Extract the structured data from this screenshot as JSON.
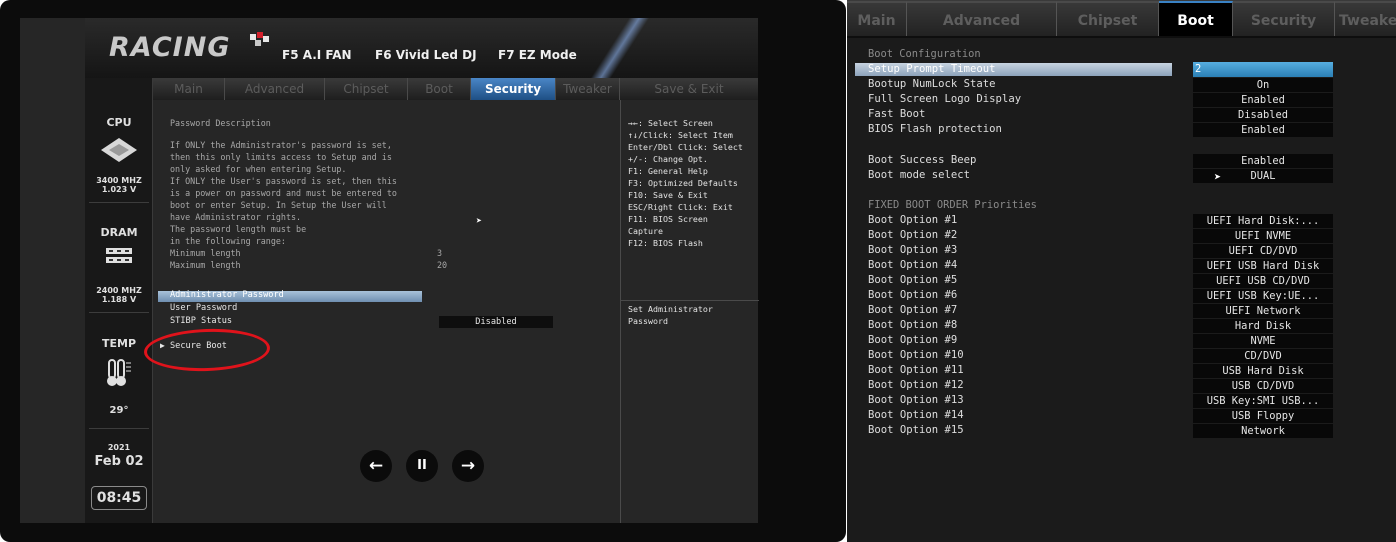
{
  "left_screen": {
    "logo_text": "RACING",
    "hotkeys": [
      "F5 A.I FAN",
      "F6 Vivid Led DJ",
      "F7 EZ Mode"
    ],
    "sidebar": {
      "cpu_label": "CPU",
      "cpu_freq": "3400 MHZ",
      "cpu_volt": "1.023 V",
      "dram_label": "DRAM",
      "dram_freq": "2400 MHZ",
      "dram_volt": "1.188 V",
      "temp_label": "TEMP",
      "temp_value": "29°",
      "year": "2021",
      "date": "Feb 02",
      "time": "08:45"
    },
    "tabs": [
      "Main",
      "Advanced",
      "Chipset",
      "Boot",
      "Security",
      "Tweaker",
      "Save & Exit"
    ],
    "active_tab": "Security",
    "description_lines": [
      "Password Description",
      "",
      "If ONLY the Administrator's password is set,",
      "then this only limits access to Setup and is",
      "only asked for when entering Setup.",
      "If ONLY the User's password is set, then this",
      "is a power on password and must be entered to",
      "boot or enter Setup. In Setup the User will",
      "have Administrator rights.",
      "The password length must be",
      "in the following range:"
    ],
    "min_length_label": "Minimum length",
    "min_length_value": "3",
    "max_length_label": "Maximum length",
    "max_length_value": "20",
    "items": {
      "admin_password": "Administrator Password",
      "user_password": "User Password",
      "stibp_label": "STIBP Status",
      "stibp_value": "Disabled",
      "secure_boot": "Secure Boot"
    },
    "help_keys": [
      "→←: Select Screen",
      "↑↓/Click: Select Item",
      "Enter/Dbl Click: Select",
      "+/-: Change Opt.",
      "F1: General Help",
      "F3: Optimized Defaults",
      "F10: Save & Exit",
      "ESC/Right Click: Exit",
      "F11: BIOS Screen",
      "Capture",
      "F12: BIOS Flash"
    ],
    "help_description": [
      "Set Administrator",
      "Password"
    ],
    "media_buttons": {
      "prev": "←",
      "pause": "II",
      "next": "→"
    }
  },
  "right_screen": {
    "tabs": [
      "Main",
      "Advanced",
      "Chipset",
      "Boot",
      "Security",
      "Tweake"
    ],
    "active_tab": "Boot",
    "section_boot_config": "Boot Configuration",
    "settings": [
      {
        "label": "Setup Prompt Timeout",
        "value": "2"
      },
      {
        "label": "Bootup NumLock State",
        "value": "On"
      },
      {
        "label": "Full Screen Logo Display",
        "value": "Enabled"
      },
      {
        "label": "Fast Boot",
        "value": "Disabled"
      },
      {
        "label": "BIOS Flash protection",
        "value": "Enabled"
      },
      {
        "label": "Boot Success Beep",
        "value": "Enabled"
      },
      {
        "label": "Boot mode select",
        "value": "DUAL"
      }
    ],
    "section_boot_order": "FIXED BOOT ORDER Priorities",
    "boot_options": [
      {
        "label": "Boot Option #1",
        "value": "UEFI Hard Disk:..."
      },
      {
        "label": "Boot Option #2",
        "value": "UEFI NVME"
      },
      {
        "label": "Boot Option #3",
        "value": "UEFI CD/DVD"
      },
      {
        "label": "Boot Option #4",
        "value": "UEFI USB Hard Disk"
      },
      {
        "label": "Boot Option #5",
        "value": "UEFI USB CD/DVD"
      },
      {
        "label": "Boot Option #6",
        "value": "UEFI USB Key:UE..."
      },
      {
        "label": "Boot Option #7",
        "value": "UEFI Network"
      },
      {
        "label": "Boot Option #8",
        "value": "Hard Disk"
      },
      {
        "label": "Boot Option #9",
        "value": "NVME"
      },
      {
        "label": "Boot Option #10",
        "value": "CD/DVD"
      },
      {
        "label": "Boot Option #11",
        "value": "USB Hard Disk"
      },
      {
        "label": "Boot Option #12",
        "value": "USB CD/DVD"
      },
      {
        "label": "Boot Option #13",
        "value": "USB Key:SMI USB..."
      },
      {
        "label": "Boot Option #14",
        "value": "USB Floppy"
      },
      {
        "label": "Boot Option #15",
        "value": "Network"
      }
    ]
  },
  "colors": {
    "active_tab": "#2f6fae",
    "highlight": "#9fb8d2",
    "annotation": "#e0131b"
  }
}
